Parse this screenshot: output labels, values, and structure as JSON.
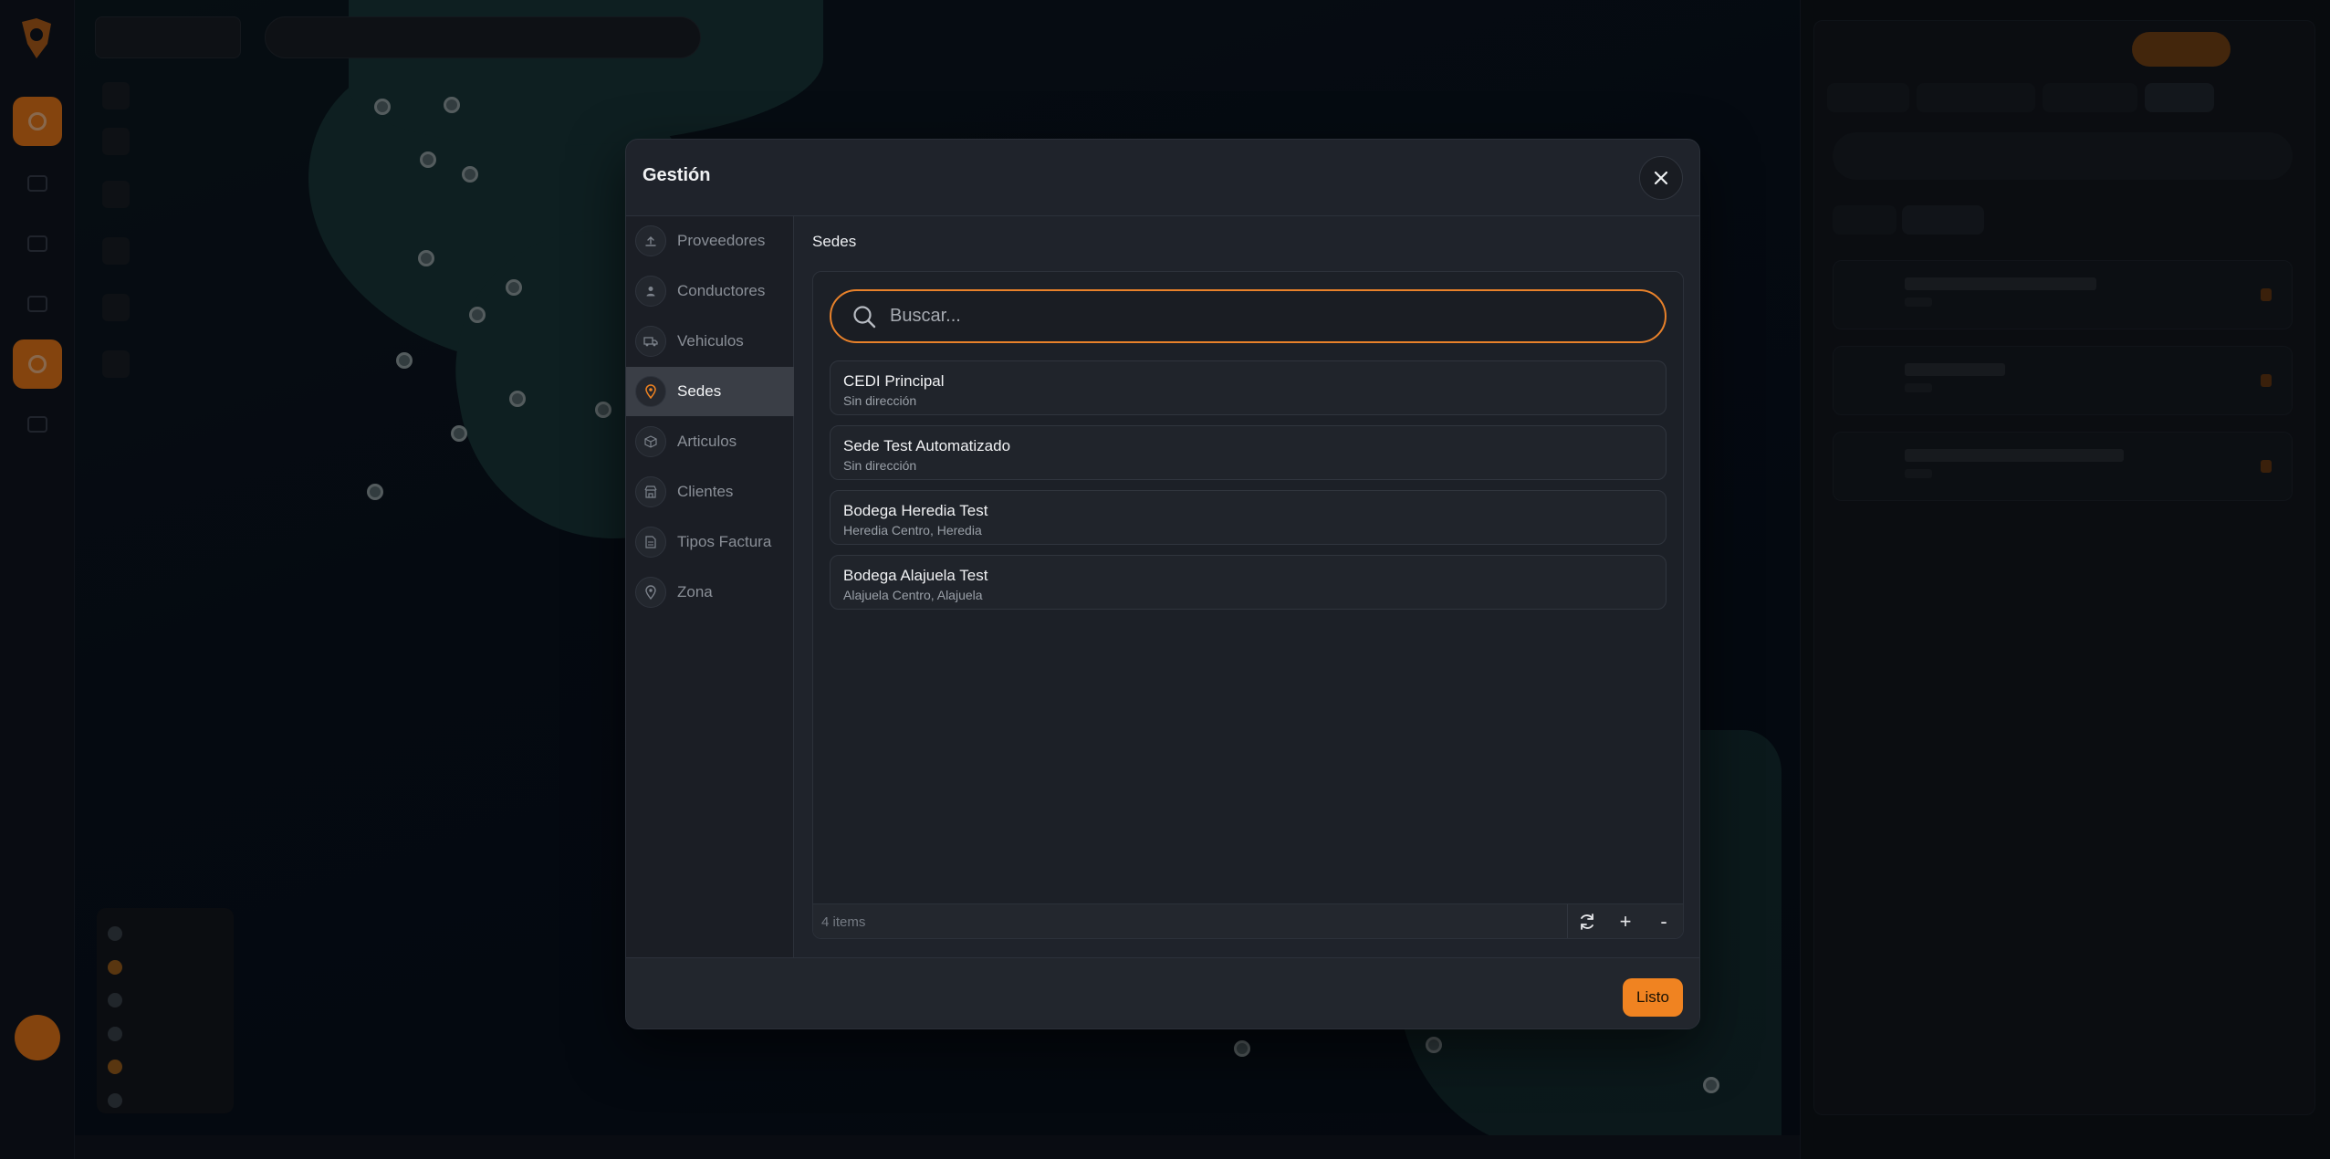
{
  "modal": {
    "title": "Gestión",
    "nav": [
      {
        "label": "Proveedores",
        "icon": "upload-icon",
        "active": false
      },
      {
        "label": "Conductores",
        "icon": "person-icon",
        "active": false
      },
      {
        "label": "Vehiculos",
        "icon": "truck-icon",
        "active": false
      },
      {
        "label": "Sedes",
        "icon": "location-pin-icon",
        "active": true
      },
      {
        "label": "Articulos",
        "icon": "box-icon",
        "active": false
      },
      {
        "label": "Clientes",
        "icon": "store-icon",
        "active": false
      },
      {
        "label": "Tipos Factura",
        "icon": "document-icon",
        "active": false
      },
      {
        "label": "Zona",
        "icon": "location-pin-icon",
        "active": false
      }
    ],
    "section_title": "Sedes",
    "search": {
      "placeholder": "Buscar...",
      "value": ""
    },
    "rows": [
      {
        "title": "CEDI Principal",
        "subtitle": "Sin dirección"
      },
      {
        "title": "Sede Test Automatizado",
        "subtitle": "Sin dirección"
      },
      {
        "title": "Bodega Heredia Test",
        "subtitle": "Heredia Centro, Heredia"
      },
      {
        "title": "Bodega Alajuela Test",
        "subtitle": "Alajuela Centro, Alajuela"
      }
    ],
    "items_count": "4 items",
    "footer_buttons": {
      "refresh_icon": "refresh-icon",
      "add": "+",
      "remove": "-"
    },
    "done_label": "Listo"
  },
  "colors": {
    "accent": "#f08321",
    "modal_bg": "#1f232b",
    "nav_active_bg": "#3a3e46"
  }
}
